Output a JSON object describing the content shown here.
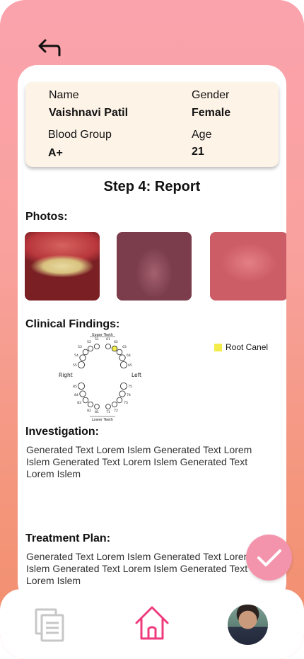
{
  "patient": {
    "name_label": "Name",
    "name_value": "Vaishnavi Patil",
    "gender_label": "Gender",
    "gender_value": "Female",
    "blood_group_label": "Blood Group",
    "blood_group_value": "A+",
    "age_label": "Age",
    "age_value": "21"
  },
  "step_title": "Step 4: Report",
  "photos": {
    "title": "Photos:",
    "items": [
      "photo-1",
      "photo-2",
      "photo-3"
    ]
  },
  "clinical": {
    "title": "Clinical Findings:",
    "legend_label": "Root Canel",
    "legend_color": "#f3ec4a",
    "upper_label": "Upper Teeth",
    "lower_label": "Lower Teeth",
    "right_label": "Right",
    "left_label": "Left"
  },
  "investigation": {
    "title": "Investigation:",
    "text": "Generated Text Lorem Islem Generated Text Lorem Islem Generated Text Lorem Islem Generated Text Lorem Islem"
  },
  "treatment": {
    "title": "Treatment Plan:",
    "text": "Generated Text Lorem Islem Generated Text Lorem Islem Generated Text Lorem Islem Generated Text Lorem Islem"
  },
  "nav": {
    "items": [
      "documents-icon",
      "home-icon",
      "avatar"
    ]
  },
  "colors": {
    "accent": "#f494ac",
    "home_icon": "#ef3b7e",
    "card_bg": "#fdf3e7"
  }
}
